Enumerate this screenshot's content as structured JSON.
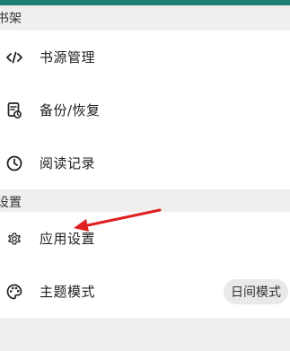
{
  "sections": {
    "bookshelf_header": "书架",
    "settings_header": "设置"
  },
  "bookshelf_items": {
    "book_source": "书源管理",
    "backup": "备份/恢复",
    "history": "阅读记录"
  },
  "settings_items": {
    "app_settings": "应用设置",
    "theme_mode": "主题模式",
    "theme_value": "日间模式"
  },
  "icons": {
    "book_source": "code-icon",
    "backup": "backup-icon",
    "history": "clock-icon",
    "app_settings": "gear-icon",
    "theme_mode": "palette-icon"
  },
  "colors": {
    "accent_bar": "#1e7f73",
    "annotation_arrow": "#e02020"
  }
}
